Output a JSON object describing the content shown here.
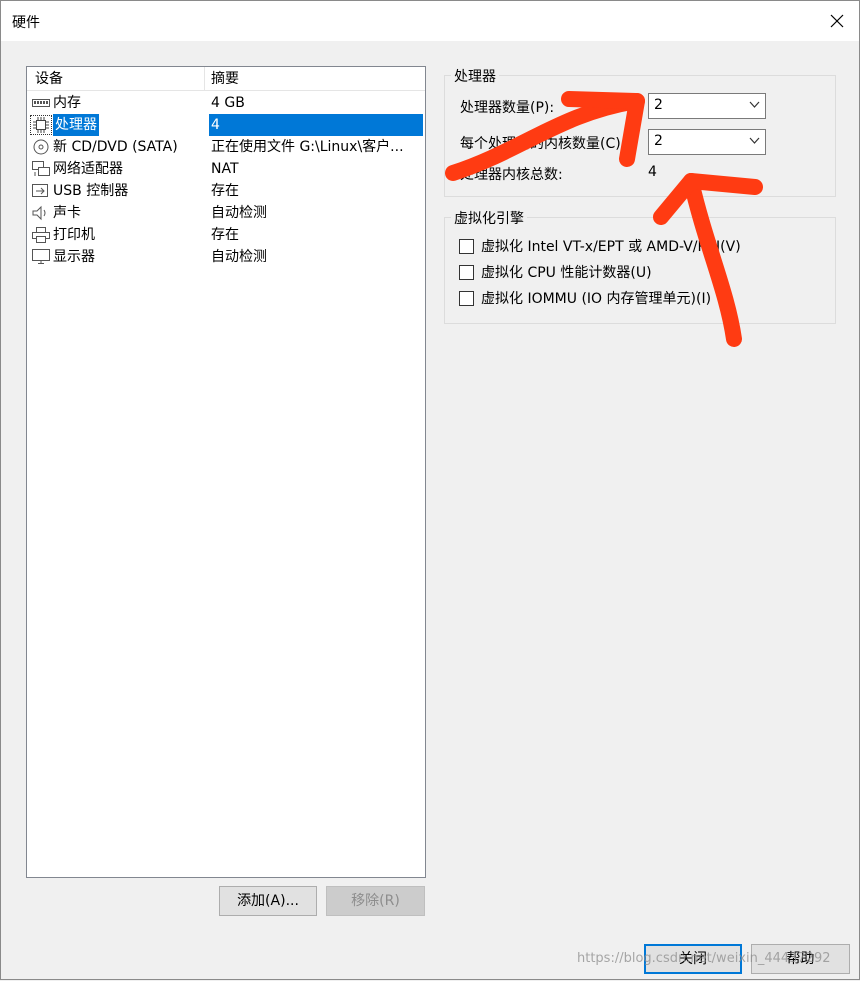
{
  "window": {
    "title": "硬件"
  },
  "device_list": {
    "headers": {
      "device": "设备",
      "summary": "摘要"
    },
    "rows": [
      {
        "icon": "memory-icon",
        "device": "内存",
        "summary": "4 GB"
      },
      {
        "icon": "processor-icon",
        "device": "处理器",
        "summary": "4"
      },
      {
        "icon": "cd-dvd-icon",
        "device": "新 CD/DVD (SATA)",
        "summary": "正在使用文件 G:\\Linux\\客户..."
      },
      {
        "icon": "network-adapter-icon",
        "device": "网络适配器",
        "summary": "NAT"
      },
      {
        "icon": "usb-icon",
        "device": "USB 控制器",
        "summary": "存在"
      },
      {
        "icon": "sound-card-icon",
        "device": "声卡",
        "summary": "自动检测"
      },
      {
        "icon": "printer-icon",
        "device": "打印机",
        "summary": "存在"
      },
      {
        "icon": "display-icon",
        "device": "显示器",
        "summary": "自动检测"
      }
    ],
    "selected_device": "处理器"
  },
  "buttons": {
    "add": "添加(A)...",
    "remove": "移除(R)",
    "close": "关闭",
    "help": "帮助"
  },
  "processor_group": {
    "title": "处理器",
    "num_processors_label": "处理器数量(P):",
    "num_processors_value": "2",
    "cores_per_processor_label": "每个处理器的内核数量(C):",
    "cores_per_processor_value": "2",
    "total_cores_label": "处理器内核总数:",
    "total_cores_value": "4"
  },
  "virtualization_group": {
    "title": "虚拟化引擎",
    "options": [
      {
        "label": "虚拟化 Intel VT-x/EPT 或 AMD-V/RVI(V)",
        "checked": false
      },
      {
        "label": "虚拟化 CPU 性能计数器(U)",
        "checked": false
      },
      {
        "label": "虚拟化 IOMMU (IO 内存管理单元)(I)",
        "checked": false
      }
    ]
  },
  "watermark": "https://blog.csdn.net/weixin_44437292",
  "colors": {
    "selection": "#0078d7",
    "annotation_arrow": "#ff3b12"
  }
}
